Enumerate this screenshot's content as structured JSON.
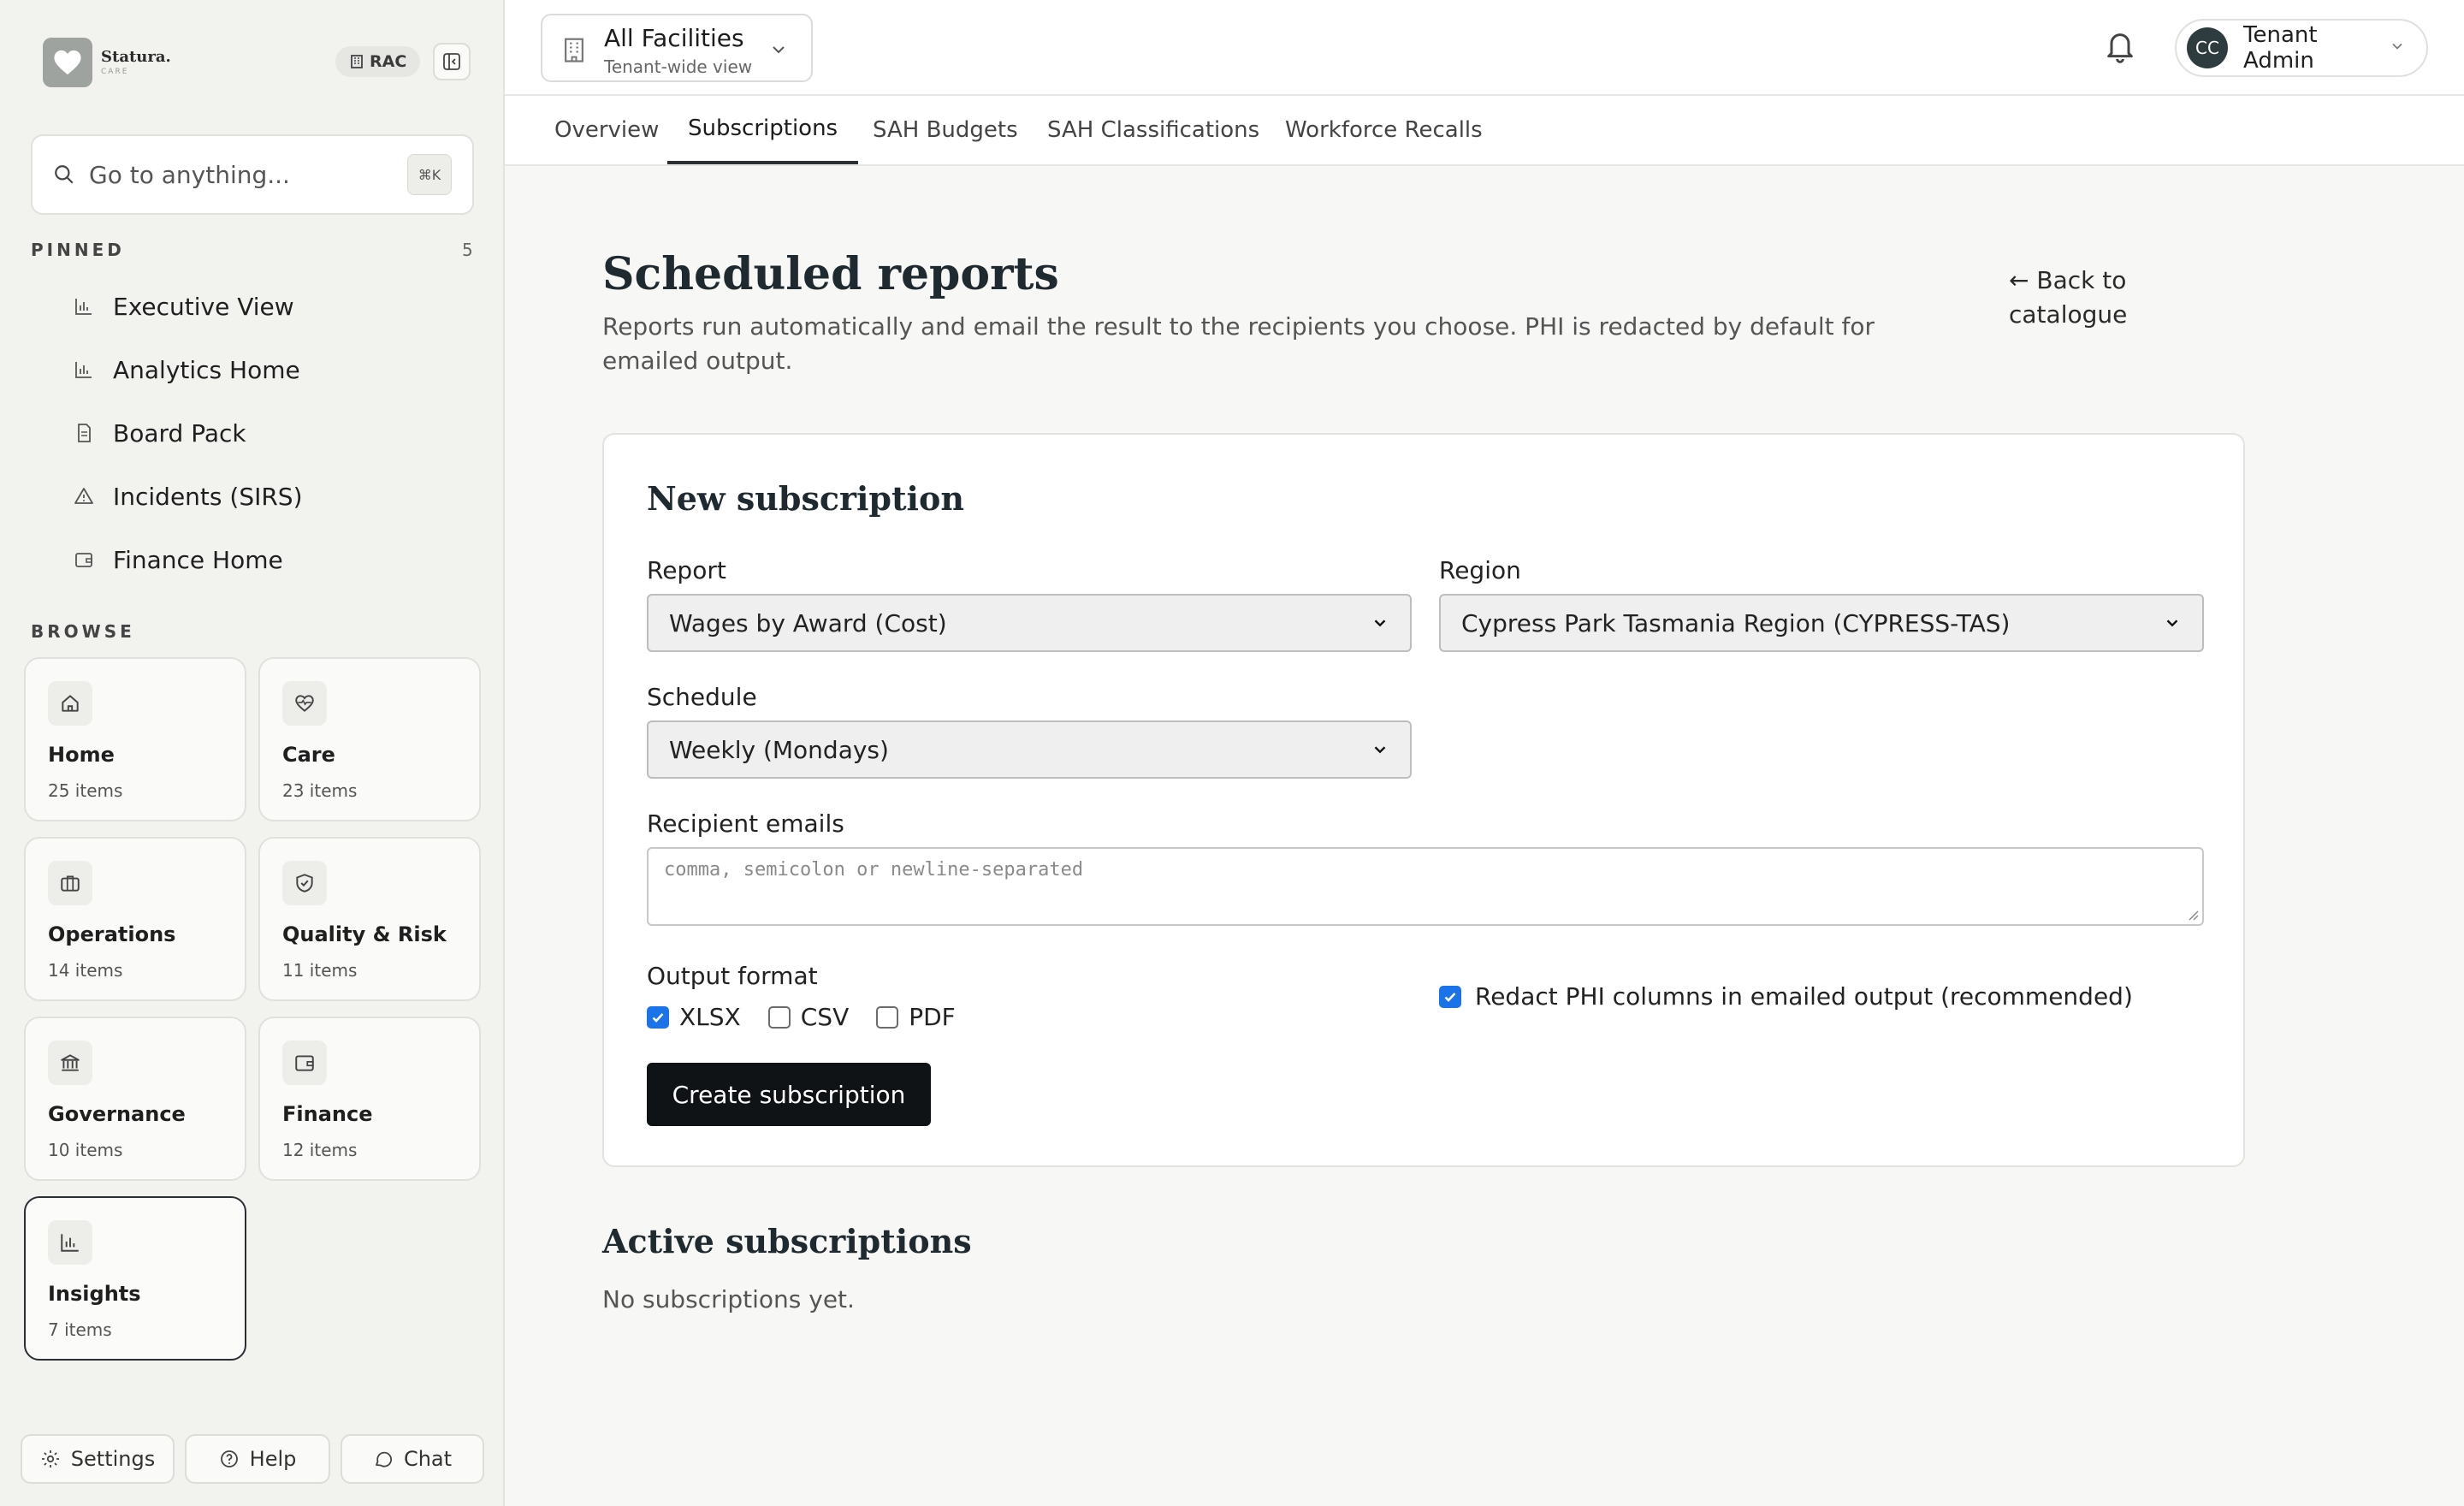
{
  "brand": {
    "name": "Statura.",
    "sub": "CARE"
  },
  "org_badge": "RAC",
  "search": {
    "placeholder": "Go to anything...",
    "shortcut": "⌘K"
  },
  "pinned": {
    "label": "PINNED",
    "count": "5",
    "items": [
      {
        "label": "Executive View",
        "icon": "bar-chart-icon"
      },
      {
        "label": "Analytics Home",
        "icon": "bar-chart-icon"
      },
      {
        "label": "Board Pack",
        "icon": "document-icon"
      },
      {
        "label": "Incidents (SIRS)",
        "icon": "warning-icon"
      },
      {
        "label": "Finance Home",
        "icon": "wallet-icon"
      }
    ]
  },
  "browse": {
    "label": "BROWSE",
    "tiles": [
      {
        "title": "Home",
        "count": "25 items",
        "icon": "home-icon"
      },
      {
        "title": "Care",
        "count": "23 items",
        "icon": "heart-pulse-icon"
      },
      {
        "title": "Operations",
        "count": "14 items",
        "icon": "briefcase-icon"
      },
      {
        "title": "Quality & Risk",
        "count": "11 items",
        "icon": "shield-check-icon"
      },
      {
        "title": "Governance",
        "count": "10 items",
        "icon": "bank-icon"
      },
      {
        "title": "Finance",
        "count": "12 items",
        "icon": "wallet-icon"
      },
      {
        "title": "Insights",
        "count": "7 items",
        "icon": "bar-chart-icon",
        "active": true
      }
    ]
  },
  "footer": {
    "settings": "Settings",
    "help": "Help",
    "chat": "Chat"
  },
  "facility": {
    "title": "All Facilities",
    "subtitle": "Tenant-wide view"
  },
  "user": {
    "initials": "CC",
    "name": "Tenant Admin"
  },
  "tabs": [
    {
      "label": "Overview"
    },
    {
      "label": "Subscriptions",
      "active": true
    },
    {
      "label": "SAH Budgets"
    },
    {
      "label": "SAH Classifications"
    },
    {
      "label": "Workforce Recalls"
    }
  ],
  "page": {
    "title": "Scheduled reports",
    "description": "Reports run automatically and email the result to the recipients you choose. PHI is redacted by default for emailed output.",
    "back_link": "← Back to catalogue"
  },
  "form": {
    "title": "New subscription",
    "report_label": "Report",
    "report_value": "Wages by Award (Cost)",
    "region_label": "Region",
    "region_value": "Cypress Park Tasmania Region (CYPRESS-TAS)",
    "schedule_label": "Schedule",
    "schedule_value": "Weekly (Mondays)",
    "recipients_label": "Recipient emails",
    "recipients_placeholder": "comma, semicolon or newline-separated",
    "format_label": "Output format",
    "formats": [
      {
        "label": "XLSX",
        "checked": true
      },
      {
        "label": "CSV",
        "checked": false
      },
      {
        "label": "PDF",
        "checked": false
      }
    ],
    "redact_label": "Redact PHI columns in emailed output (recommended)",
    "redact_checked": true,
    "submit_label": "Create subscription"
  },
  "active": {
    "title": "Active subscriptions",
    "empty": "No subscriptions yet."
  },
  "colors": {
    "accent": "#1a73e8",
    "primary_button": "#0f1316",
    "avatar_bg": "#2e3b3f"
  }
}
